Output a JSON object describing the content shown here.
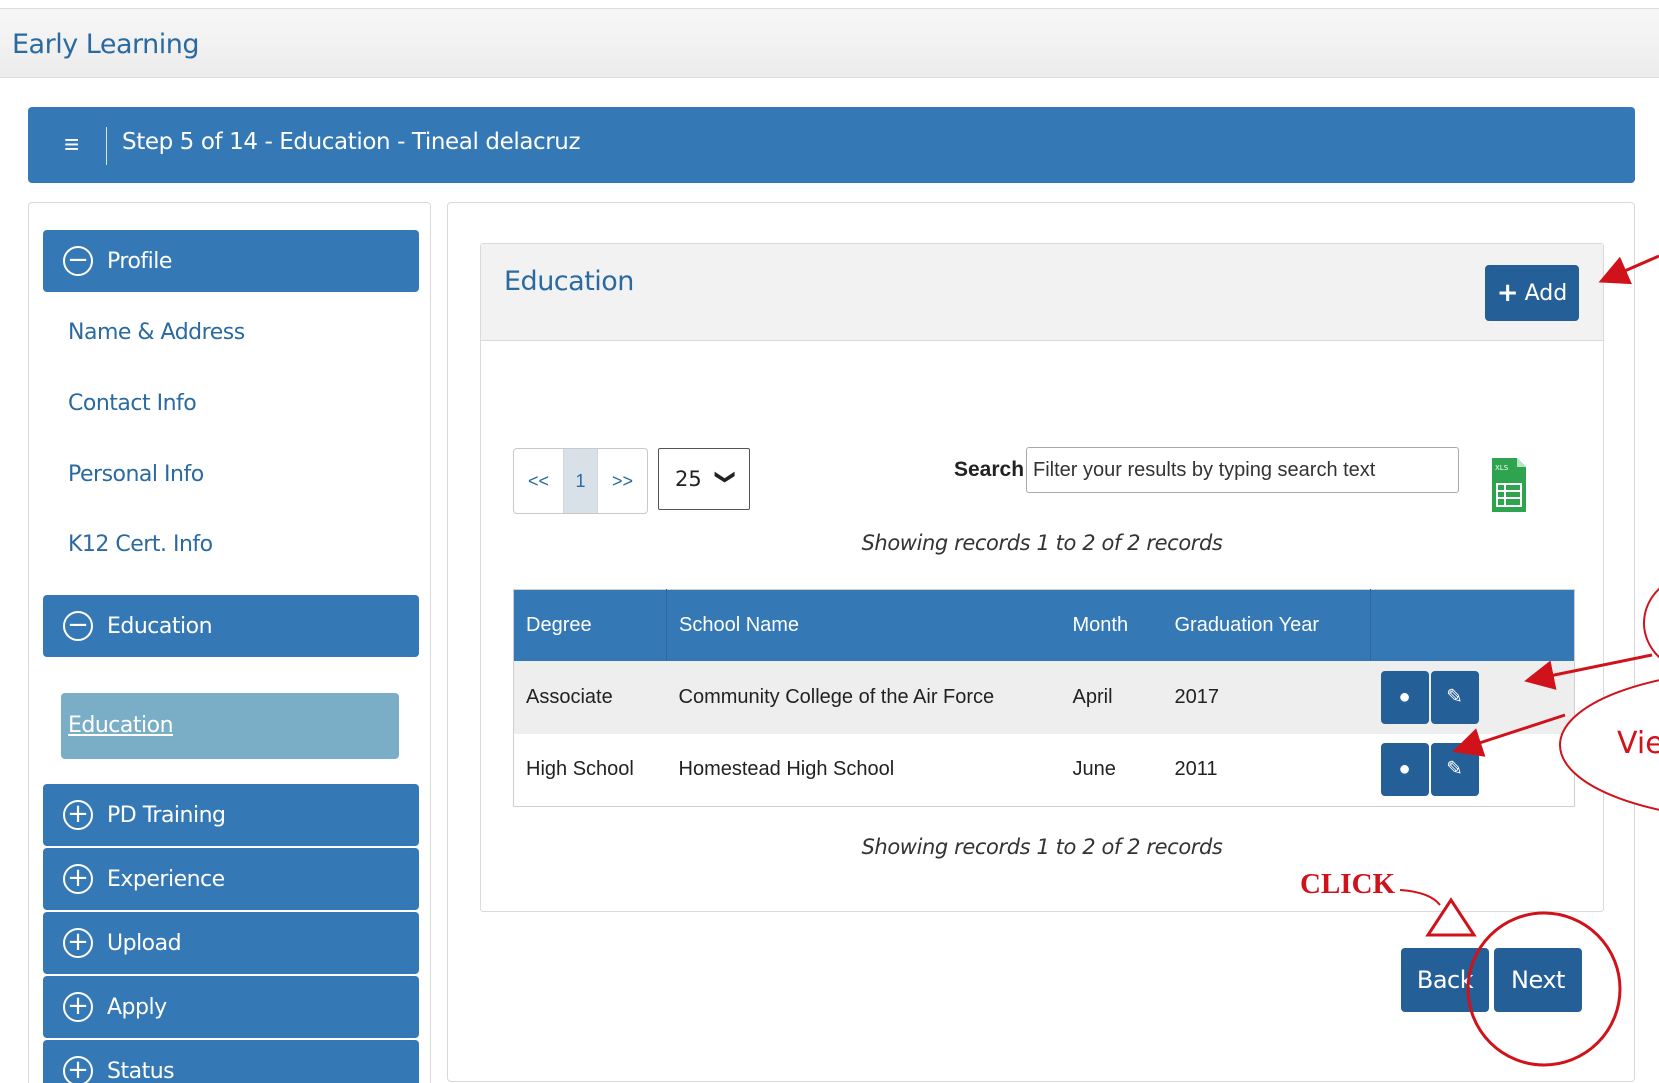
{
  "app": {
    "title": "Early Learning"
  },
  "step": {
    "menu_glyph": "≡",
    "text": "Step 5 of 14 - Education - Tineal delacruz"
  },
  "sidebar": {
    "sections": [
      {
        "label": "Profile",
        "state_glyph": "−"
      },
      {
        "label": "Education",
        "state_glyph": "−"
      },
      {
        "label": "PD Training",
        "state_glyph": "+"
      },
      {
        "label": "Experience",
        "state_glyph": "+"
      },
      {
        "label": "Upload",
        "state_glyph": "+"
      },
      {
        "label": "Apply",
        "state_glyph": "+"
      },
      {
        "label": "Status",
        "state_glyph": "+"
      }
    ],
    "profile_links": [
      "Name & Address",
      "Contact Info",
      "Personal Info",
      "K12 Cert. Info"
    ],
    "education_active": "Education"
  },
  "card": {
    "title": "Education",
    "add_label": "Add",
    "add_glyph": "+"
  },
  "pager": {
    "first": "<<",
    "current": "1",
    "next": ">>",
    "page_size": "25",
    "chevron": "❯"
  },
  "search": {
    "label": "Search",
    "placeholder": "Filter your results by typing search text"
  },
  "showing_text": "Showing records 1 to 2 of 2 records",
  "table": {
    "columns": [
      "Degree",
      "School Name",
      "Month",
      "Graduation Year",
      ""
    ],
    "rows": [
      {
        "degree": "Associate",
        "school": "Community College of the Air Force",
        "month": "April",
        "year": "2017"
      },
      {
        "degree": "High School",
        "school": "Homestead High School",
        "month": "June",
        "year": "2011"
      }
    ],
    "view_glyph": "●",
    "edit_glyph": "✎"
  },
  "nav": {
    "back": "Back",
    "next": "Next"
  },
  "annotations": {
    "click": "CLICK",
    "view": "Vie"
  },
  "colors": {
    "primary": "#3478b5",
    "button": "#245f97",
    "annotation": "#d0121b",
    "active_item": "#79aec6",
    "excel": "#2ea44f"
  }
}
